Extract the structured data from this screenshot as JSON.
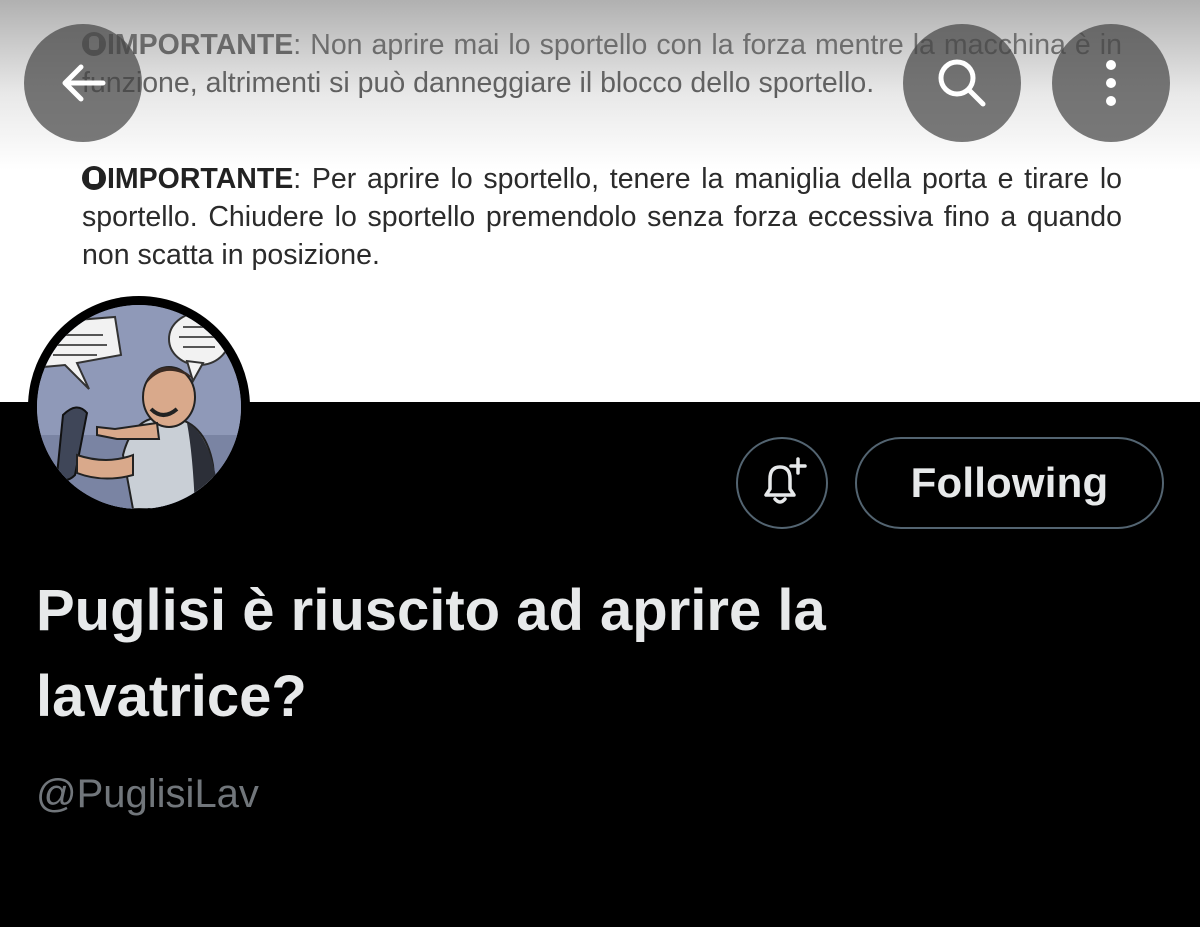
{
  "banner": {
    "notices": [
      {
        "lead": "IMPORTANTE",
        "text": ": Non aprire mai lo sportello con la forza mentre la macchina è in funzione, altrimenti si può danneggiare il blocco dello sportello."
      },
      {
        "lead": "IMPORTANTE",
        "text": ": Per aprire lo sportello, tenere la maniglia della porta e tirare lo sportello. Chiudere lo sportello premendolo senza forza eccessiva fino a quando non scatta in posizione."
      }
    ]
  },
  "nav": {
    "back_icon": "arrow-left-icon",
    "search_icon": "search-icon",
    "more_icon": "more-vertical-icon"
  },
  "profile": {
    "name": "Puglisi è riuscito ad aprire la lavatrice?",
    "handle": "@PuglisiLav",
    "notify_icon": "bell-plus-icon",
    "follow_label": "Following"
  },
  "colors": {
    "background": "#000000",
    "primary_text": "#e7e9ea",
    "secondary_text": "#71767b",
    "button_border": "#536471",
    "nav_button_bg": "#464646"
  }
}
